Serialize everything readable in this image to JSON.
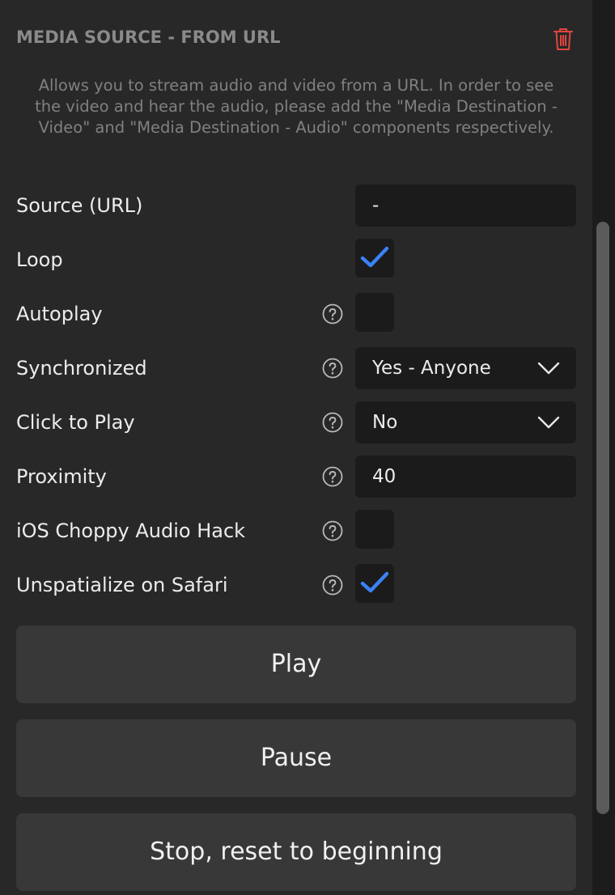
{
  "header": {
    "title": "MEDIA SOURCE - FROM URL",
    "delete_icon": "trash-icon",
    "delete_color": "#e0463f"
  },
  "description": "Allows you to stream audio and video from a URL. In order to see the video and hear the audio, please add the \"Media Destination - Video\" and \"Media Destination - Audio\" components respectively.",
  "fields": {
    "source_url": {
      "label": "Source (URL)",
      "value": "-"
    },
    "loop": {
      "label": "Loop",
      "checked": true
    },
    "autoplay": {
      "label": "Autoplay",
      "checked": false
    },
    "synchronized": {
      "label": "Synchronized",
      "value": "Yes - Anyone"
    },
    "click_to_play": {
      "label": "Click to Play",
      "value": "No"
    },
    "proximity": {
      "label": "Proximity",
      "value": "40"
    },
    "ios_choppy_audio_hack": {
      "label": "iOS Choppy Audio Hack",
      "checked": false
    },
    "unspatialize_on_safari": {
      "label": "Unspatialize on Safari",
      "checked": true
    }
  },
  "actions": {
    "play": "Play",
    "pause": "Pause",
    "stop": "Stop, reset to beginning"
  },
  "colors": {
    "check_accent": "#3b82f6",
    "panel_bg": "#282828",
    "field_bg": "#1b1b1b",
    "button_bg": "#383838"
  }
}
